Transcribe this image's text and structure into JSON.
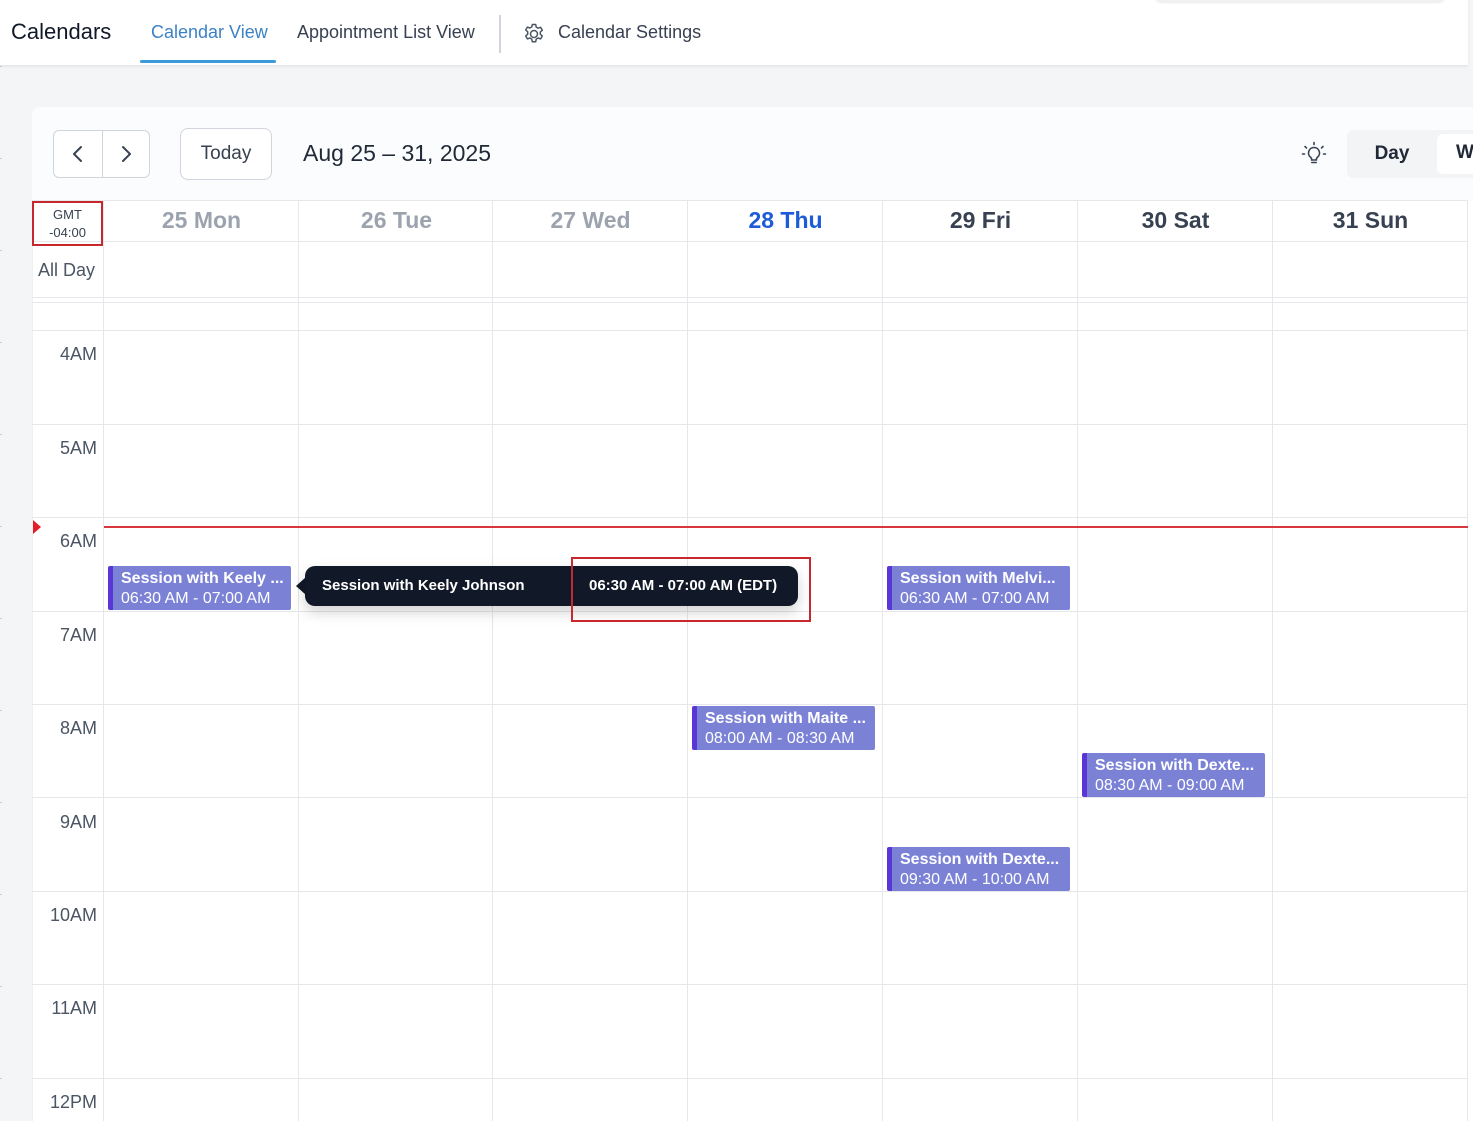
{
  "header": {
    "app_title": "Calendars",
    "tabs": [
      {
        "label": "Calendar View",
        "active": true
      },
      {
        "label": "Appointment List View",
        "active": false
      }
    ],
    "settings_label": "Calendar Settings",
    "accent_color": "#3b9ad9"
  },
  "toolbar": {
    "prev_icon": "chevron-left-icon",
    "next_icon": "chevron-right-icon",
    "today_label": "Today",
    "range_title": "Aug 25 – 31, 2025",
    "theme_icon": "lightbulb-icon",
    "views": [
      {
        "label": "Day",
        "active": false
      },
      {
        "label": "W",
        "active": true
      }
    ]
  },
  "grid": {
    "timezone_line1": "GMT",
    "timezone_line2": "-04:00",
    "all_day_label": "All Day",
    "days": [
      {
        "label": "25 Mon",
        "state": "past"
      },
      {
        "label": "26 Tue",
        "state": "past"
      },
      {
        "label": "27 Wed",
        "state": "past"
      },
      {
        "label": "28 Thu",
        "state": "today"
      },
      {
        "label": "29 Fri",
        "state": "future"
      },
      {
        "label": "30 Sat",
        "state": "future"
      },
      {
        "label": "31 Sun",
        "state": "future"
      }
    ],
    "hours": [
      "4AM",
      "5AM",
      "6AM",
      "7AM",
      "8AM",
      "9AM",
      "10AM",
      "11AM",
      "12PM"
    ],
    "now_indicator_color": "#d9363e"
  },
  "events": [
    {
      "title": "Session with Keely ...",
      "time": "06:30 AM - 07:00 AM"
    },
    {
      "title": "Session with Melvi...",
      "time": "06:30 AM - 07:00 AM"
    },
    {
      "title": "Session with Maite ...",
      "time": "08:00 AM - 08:30 AM"
    },
    {
      "title": "Session with Dexte...",
      "time": "08:30 AM - 09:00 AM"
    },
    {
      "title": "Session with Dexte...",
      "time": "09:30 AM - 10:00 AM"
    }
  ],
  "event_color": "#7b82d6",
  "event_accent_color": "#5b36d6",
  "tooltip": {
    "title": "Session with Keely Johnson",
    "time": "06:30 AM - 07:00 AM (EDT)"
  }
}
